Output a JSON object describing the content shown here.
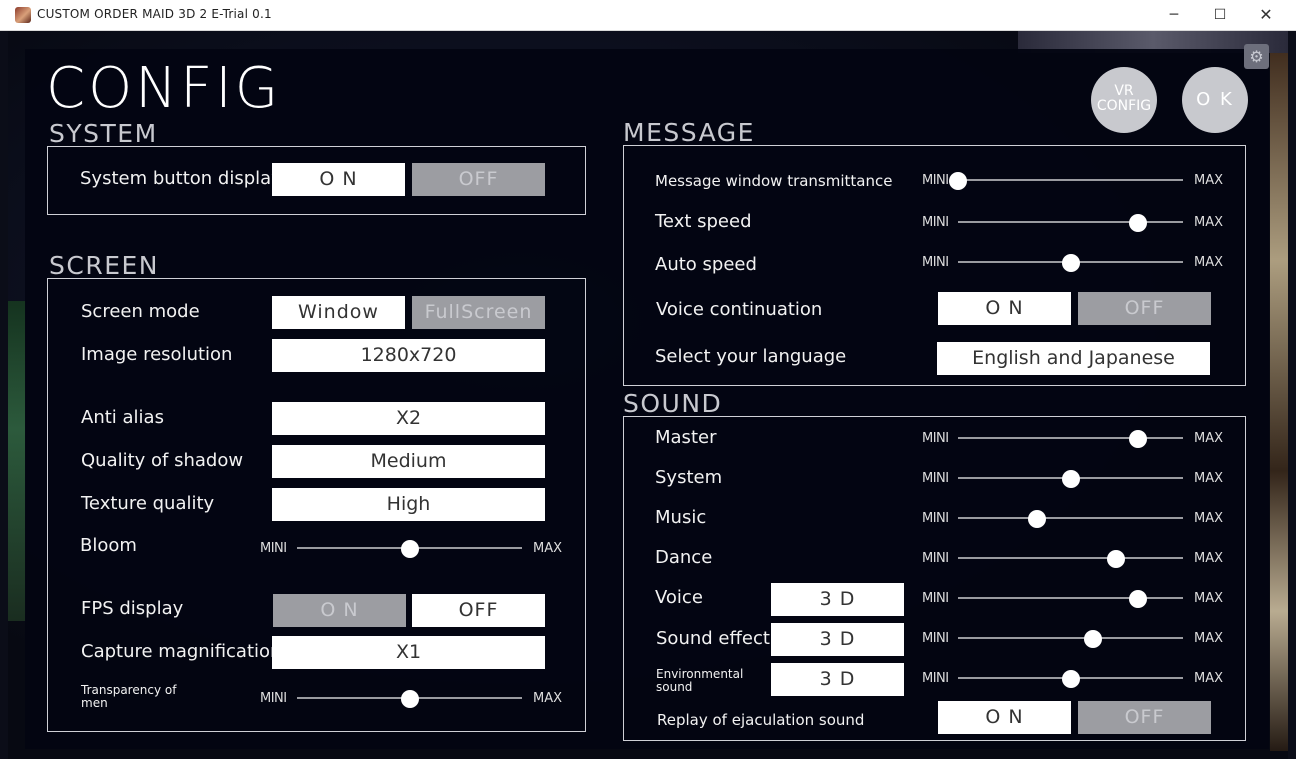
{
  "window": {
    "title": "CUSTOM ORDER MAID 3D 2 E-Trial 0.1",
    "min": "─",
    "max": "☐",
    "close": "✕"
  },
  "page_title": "CONFIG",
  "header_buttons": {
    "vr_line1": "VR",
    "vr_line2": "CONFIG",
    "ok": "O K"
  },
  "slider_labels": {
    "mini": "MINI",
    "max": "MAX"
  },
  "system": {
    "title": "SYSTEM",
    "system_button_display": {
      "label": "System button display",
      "on": "O N",
      "off": "OFF",
      "value": "on"
    }
  },
  "screen": {
    "title": "SCREEN",
    "screen_mode": {
      "label": "Screen mode",
      "options": [
        "Window",
        "FullScreen"
      ],
      "value": "Window"
    },
    "image_resolution": {
      "label": "Image resolution",
      "value": "1280x720"
    },
    "anti_alias": {
      "label": "Anti alias",
      "value": "X2"
    },
    "quality_of_shadow": {
      "label": "Quality of shadow",
      "value": "Medium"
    },
    "texture_quality": {
      "label": "Texture quality",
      "value": "High"
    },
    "bloom": {
      "label": "Bloom",
      "level": 0.5
    },
    "fps_display": {
      "label": "FPS display",
      "on": "O N",
      "off": "OFF",
      "value": "off"
    },
    "capture_magnification": {
      "label": "Capture magnification",
      "value": "X1"
    },
    "transparency_of_men": {
      "label_line1": "Transparency of",
      "label_line2": "men",
      "level": 0.5
    }
  },
  "message": {
    "title": "MESSAGE",
    "window_transmittance": {
      "label": "Message window transmittance",
      "level": 0.0
    },
    "text_speed": {
      "label": "Text speed",
      "level": 0.8
    },
    "auto_speed": {
      "label": "Auto speed",
      "level": 0.5
    },
    "voice_continuation": {
      "label": "Voice continuation",
      "on": "O N",
      "off": "OFF",
      "value": "on"
    },
    "language": {
      "label": "Select your language",
      "value": "English and Japanese"
    }
  },
  "sound": {
    "title": "SOUND",
    "master": {
      "label": "Master",
      "level": 0.8
    },
    "system": {
      "label": "System",
      "level": 0.5
    },
    "music": {
      "label": "Music",
      "level": 0.35
    },
    "dance": {
      "label": "Dance",
      "level": 0.7
    },
    "voice": {
      "label": "Voice",
      "mode": "3 D",
      "level": 0.8
    },
    "sound_effect": {
      "label": "Sound effect",
      "mode": "3 D",
      "level": 0.6
    },
    "environmental_sound": {
      "label_line1": "Environmental",
      "label_line2": "sound",
      "mode": "3 D",
      "level": 0.5
    },
    "replay_ejaculation": {
      "label": "Replay of ejaculation sound",
      "on": "O N",
      "off": "OFF",
      "value": "on"
    }
  },
  "colors": {
    "panel": "#03050f",
    "button": "#ffffff",
    "button_off": "#9c9da2",
    "round_button": "#c8c9ce",
    "text": "#f2f2f2"
  }
}
